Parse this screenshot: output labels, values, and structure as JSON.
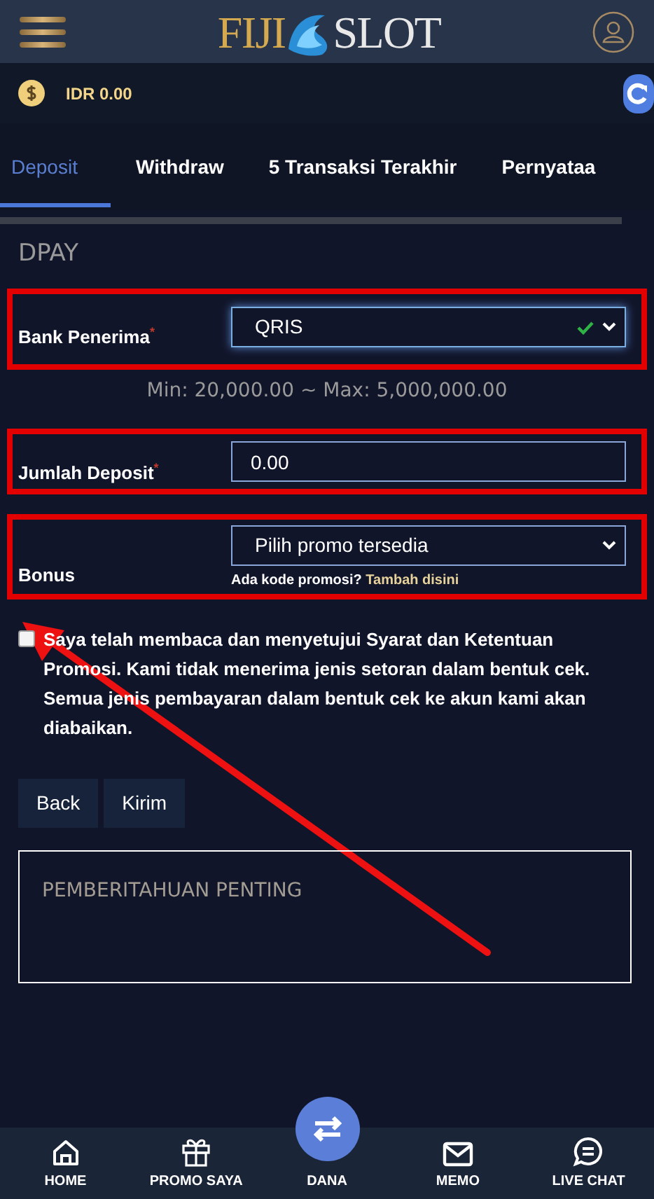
{
  "header": {
    "logo_left": "FIJI",
    "logo_right": "SLOT"
  },
  "balance": {
    "amount": "IDR 0.00"
  },
  "tabs": [
    {
      "label": "Deposit",
      "selected": true
    },
    {
      "label": "Withdraw",
      "selected": false
    },
    {
      "label": "5 Transaksi Terakhir",
      "selected": false
    },
    {
      "label": "Pernyataa",
      "selected": false
    }
  ],
  "section_title": "DPAY",
  "bank": {
    "label": "Bank Penerima",
    "required_mark": "*",
    "value": "QRIS",
    "valid": true,
    "highlighted": true
  },
  "range_note": "Min: 20,000.00 ~ Max: 5,000,000.00",
  "amount": {
    "label": "Jumlah Deposit",
    "required_mark": "*",
    "value": "0.00",
    "highlighted": true
  },
  "bonus": {
    "label": "Bonus",
    "value": "Pilih promo tersedia",
    "hint": "Ada kode promosi?",
    "hint_link": "Tambah disini",
    "highlighted": true
  },
  "agreement": {
    "checked": false,
    "text": "Saya telah membaca dan menyetujui Syarat dan Ketentuan Promosi. Kami tidak menerima jenis setoran dalam bentuk cek. Semua jenis pembayaran dalam bentuk cek ke akun kami akan diabaikan."
  },
  "buttons": [
    "Back",
    "Kirim"
  ],
  "notice": {
    "title": "PEMBERITAHUAN PENTING"
  },
  "annotation_arrow": true,
  "bottom_nav": [
    {
      "label": "HOME",
      "kind": "home"
    },
    {
      "label": "PROMO SAYA",
      "kind": "gift"
    },
    {
      "label": "DANA",
      "kind": "transfer"
    },
    {
      "label": "MEMO",
      "kind": "mail"
    },
    {
      "label": "LIVE CHAT",
      "kind": "chat"
    }
  ]
}
